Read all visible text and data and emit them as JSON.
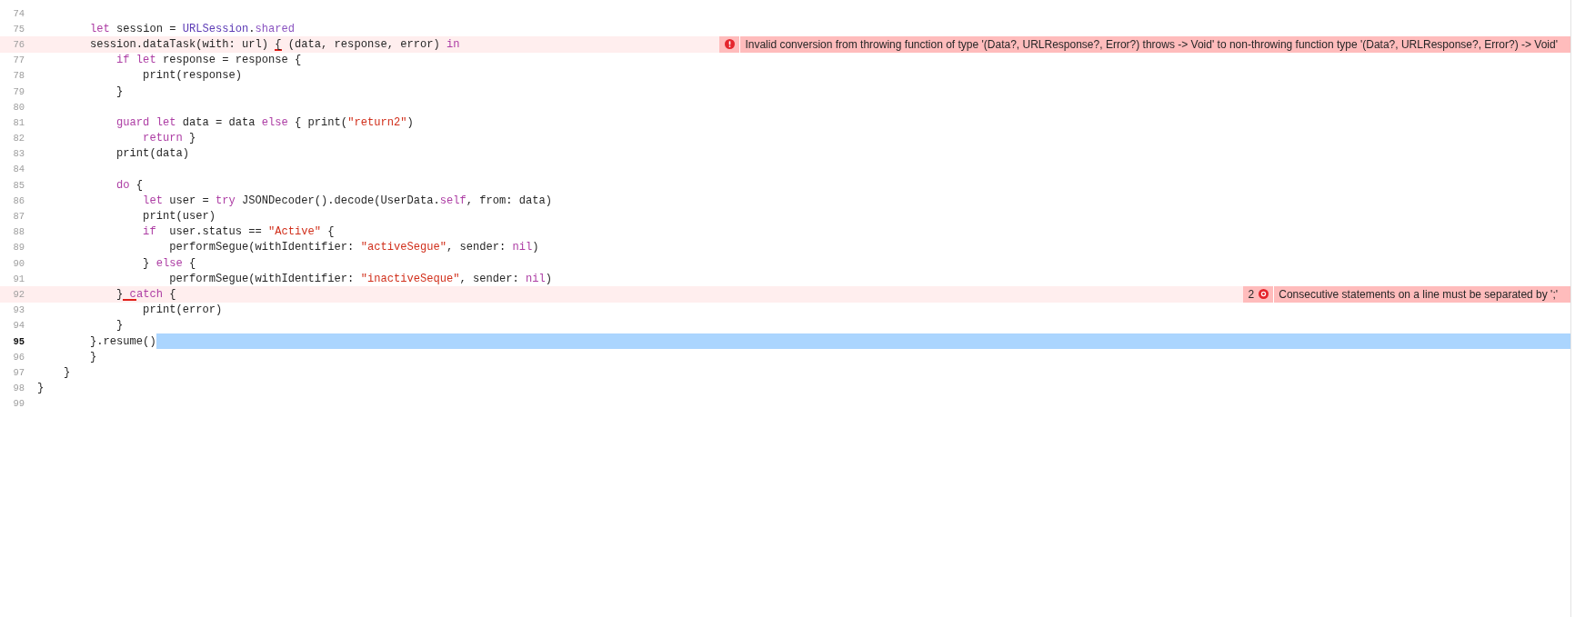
{
  "editor": {
    "lines": [
      {
        "number": "74"
      },
      {
        "number": "75",
        "segments": [
          {
            "kind": "keyword",
            "text": "        let"
          },
          {
            "kind": "plain",
            "text": " session = "
          },
          {
            "kind": "type",
            "text": "URLSession"
          },
          {
            "kind": "plain",
            "text": "."
          },
          {
            "kind": "property",
            "text": "shared"
          }
        ]
      },
      {
        "number": "76",
        "segments": [
          {
            "kind": "plain",
            "text": "        session.dataTask(with: url) "
          },
          {
            "kind": "plain",
            "text": "{",
            "underline": true
          },
          {
            "kind": "plain",
            "text": " (data, response, error) "
          },
          {
            "kind": "keyword",
            "text": "in"
          }
        ],
        "annotation": {
          "kind": "single",
          "message": "Invalid conversion from throwing function of type '(Data?, URLResponse?, Error?) throws -> Void' to non-throwing function type '(Data?, URLResponse?, Error?) -> Void'"
        }
      },
      {
        "number": "77",
        "segments": [
          {
            "kind": "keyword",
            "text": "            if"
          },
          {
            "kind": "keyword",
            "text": " let"
          },
          {
            "kind": "plain",
            "text": " response = response {"
          }
        ]
      },
      {
        "number": "78",
        "segments": [
          {
            "kind": "plain",
            "text": "                print(response)"
          }
        ]
      },
      {
        "number": "79",
        "segments": [
          {
            "kind": "plain",
            "text": "            }"
          }
        ]
      },
      {
        "number": "80"
      },
      {
        "number": "81",
        "segments": [
          {
            "kind": "keyword",
            "text": "            guard"
          },
          {
            "kind": "keyword",
            "text": " let"
          },
          {
            "kind": "plain",
            "text": " data = data "
          },
          {
            "kind": "keyword",
            "text": "else"
          },
          {
            "kind": "plain",
            "text": " { print("
          },
          {
            "kind": "string",
            "text": "\"return2\""
          },
          {
            "kind": "plain",
            "text": ")"
          }
        ]
      },
      {
        "number": "82",
        "segments": [
          {
            "kind": "keyword",
            "text": "                return"
          },
          {
            "kind": "plain",
            "text": " }"
          }
        ]
      },
      {
        "number": "83",
        "segments": [
          {
            "kind": "plain",
            "text": "            print(data)"
          }
        ]
      },
      {
        "number": "84"
      },
      {
        "number": "85",
        "segments": [
          {
            "kind": "keyword",
            "text": "            do"
          },
          {
            "kind": "plain",
            "text": " {"
          }
        ]
      },
      {
        "number": "86",
        "segments": [
          {
            "kind": "keyword",
            "text": "                let"
          },
          {
            "kind": "plain",
            "text": " user = "
          },
          {
            "kind": "keyword",
            "text": "try"
          },
          {
            "kind": "plain",
            "text": " JSONDecoder().decode(UserData."
          },
          {
            "kind": "keyword",
            "text": "self"
          },
          {
            "kind": "plain",
            "text": ", from: data)"
          }
        ]
      },
      {
        "number": "87",
        "segments": [
          {
            "kind": "plain",
            "text": "                print(user)"
          }
        ]
      },
      {
        "number": "88",
        "segments": [
          {
            "kind": "keyword",
            "text": "                if"
          },
          {
            "kind": "plain",
            "text": "  user.status == "
          },
          {
            "kind": "string",
            "text": "\"Active\""
          },
          {
            "kind": "plain",
            "text": " {"
          }
        ]
      },
      {
        "number": "89",
        "segments": [
          {
            "kind": "plain",
            "text": "                    performSegue(withIdentifier: "
          },
          {
            "kind": "string",
            "text": "\"activeSegue\""
          },
          {
            "kind": "plain",
            "text": ", sender: "
          },
          {
            "kind": "keyword",
            "text": "nil"
          },
          {
            "kind": "plain",
            "text": ")"
          }
        ]
      },
      {
        "number": "90",
        "segments": [
          {
            "kind": "plain",
            "text": "                } "
          },
          {
            "kind": "keyword",
            "text": "else"
          },
          {
            "kind": "plain",
            "text": " {"
          }
        ]
      },
      {
        "number": "91",
        "segments": [
          {
            "kind": "plain",
            "text": "                    performSegue(withIdentifier: "
          },
          {
            "kind": "string",
            "text": "\"inactiveSeque\""
          },
          {
            "kind": "plain",
            "text": ", sender: "
          },
          {
            "kind": "keyword",
            "text": "nil"
          },
          {
            "kind": "plain",
            "text": ")"
          }
        ]
      },
      {
        "number": "92",
        "segments": [
          {
            "kind": "plain",
            "text": "            }"
          },
          {
            "kind": "keyword",
            "text": " c",
            "underline": true
          },
          {
            "kind": "keyword",
            "text": "atch"
          },
          {
            "kind": "plain",
            "text": " {"
          }
        ],
        "annotation": {
          "kind": "grouped",
          "count": "2",
          "message": "Consecutive statements on a line must be separated by ';'"
        }
      },
      {
        "number": "93",
        "segments": [
          {
            "kind": "plain",
            "text": "                print(error)"
          }
        ]
      },
      {
        "number": "94",
        "segments": [
          {
            "kind": "plain",
            "text": "            }"
          }
        ]
      },
      {
        "number": "95",
        "current": true,
        "segments": [
          {
            "kind": "plain",
            "text": "        }.resume()"
          }
        ]
      },
      {
        "number": "96",
        "segments": [
          {
            "kind": "plain",
            "text": "        }"
          }
        ]
      },
      {
        "number": "97",
        "segments": [
          {
            "kind": "plain",
            "text": "    }"
          }
        ]
      },
      {
        "number": "98",
        "segments": [
          {
            "kind": "plain",
            "text": "}"
          }
        ]
      },
      {
        "number": "99"
      }
    ]
  }
}
